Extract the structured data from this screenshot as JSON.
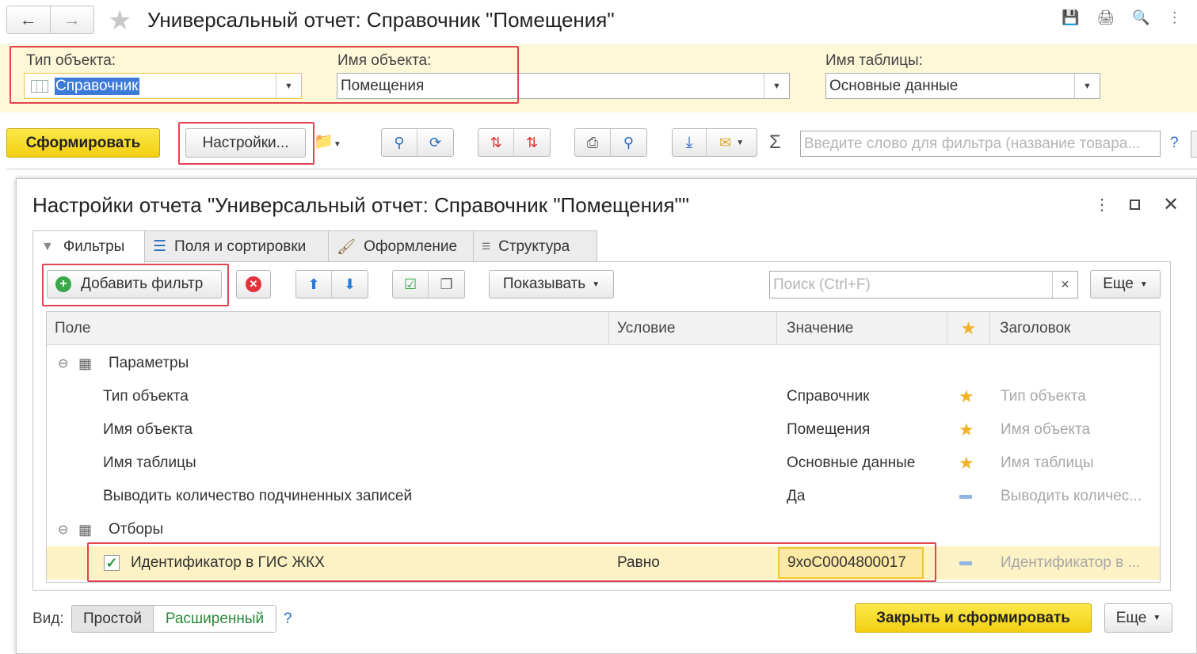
{
  "window": {
    "title": "Универсальный отчет: Справочник \"Помещения\""
  },
  "params": {
    "object_type_label": "Тип объекта:",
    "object_type_value": "Справочник",
    "object_name_label": "Имя объекта:",
    "object_name_value": "Помещения",
    "table_name_label": "Имя таблицы:",
    "table_name_value": "Основные данные"
  },
  "toolbar": {
    "generate": "Сформировать",
    "settings": "Настройки...",
    "search_placeholder": "Введите слово для фильтра (название товара...",
    "help": "?"
  },
  "dialog": {
    "title": "Настройки отчета \"Универсальный отчет: Справочник \"Помещения\"\"",
    "tabs": [
      {
        "label": "Фильтры"
      },
      {
        "label": "Поля и сортировки"
      },
      {
        "label": "Оформление"
      },
      {
        "label": "Структура"
      }
    ],
    "add_filter": "Добавить фильтр",
    "show": "Показывать",
    "search_placeholder": "Поиск (Ctrl+F)",
    "more": "Еще",
    "columns": {
      "field": "Поле",
      "condition": "Условие",
      "value": "Значение",
      "title": "Заголовок"
    },
    "groups": {
      "params": "Параметры",
      "filters": "Отборы"
    },
    "rows": [
      {
        "field": "Тип объекта",
        "value": "Справочник",
        "title": "Тип объекта"
      },
      {
        "field": "Имя объекта",
        "value": "Помещения",
        "title": "Имя объекта"
      },
      {
        "field": "Имя таблицы",
        "value": "Основные данные",
        "title": "Имя таблицы"
      },
      {
        "field": "Выводить количество подчиненных записей",
        "value": "Да",
        "title": "Выводить количес..."
      }
    ],
    "filter_row": {
      "field": "Идентификатор в ГИС ЖКХ",
      "condition": "Равно",
      "value": "9хоС0004800017",
      "title": "Идентификатор в ..."
    },
    "view_label": "Вид:",
    "view_simple": "Простой",
    "view_extended": "Расширенный",
    "help": "?",
    "close_generate": "Закрыть и сформировать",
    "more_bottom": "Еще"
  }
}
